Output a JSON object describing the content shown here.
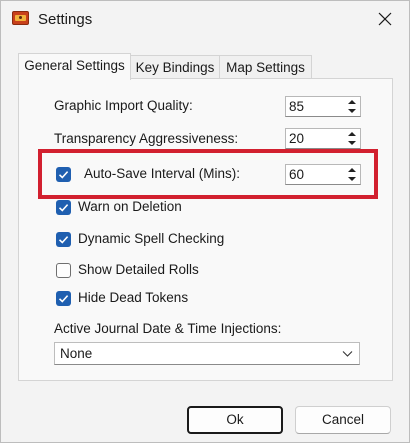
{
  "window": {
    "title": "Settings",
    "icon": "treasure-chest-icon",
    "close_icon": "close-icon"
  },
  "tabs": [
    {
      "label": "General Settings",
      "active": true
    },
    {
      "label": "Key Bindings",
      "active": false
    },
    {
      "label": "Map Settings",
      "active": false
    }
  ],
  "general": {
    "graphic_import_quality": {
      "label": "Graphic Import Quality:",
      "value": "85"
    },
    "transparency": {
      "label": "Transparency Aggressiveness:",
      "value": "20"
    },
    "autosave": {
      "label": "Auto-Save Interval (Mins):",
      "value": "60",
      "checked": true
    },
    "warn_on_deletion": {
      "label": "Warn on Deletion",
      "checked": true
    },
    "spell_checking": {
      "label": "Dynamic Spell Checking",
      "checked": true
    },
    "detailed_rolls": {
      "label": "Show Detailed Rolls",
      "checked": false
    },
    "hide_dead_tokens": {
      "label": "Hide Dead Tokens",
      "checked": true
    },
    "journal_injections": {
      "label": "Active Journal Date & Time Injections:",
      "value": "None"
    }
  },
  "buttons": {
    "ok": "Ok",
    "cancel": "Cancel"
  },
  "colors": {
    "accent": "#1f5fb0",
    "highlight_box": "#d2202f",
    "background": "#f3f3f3"
  }
}
